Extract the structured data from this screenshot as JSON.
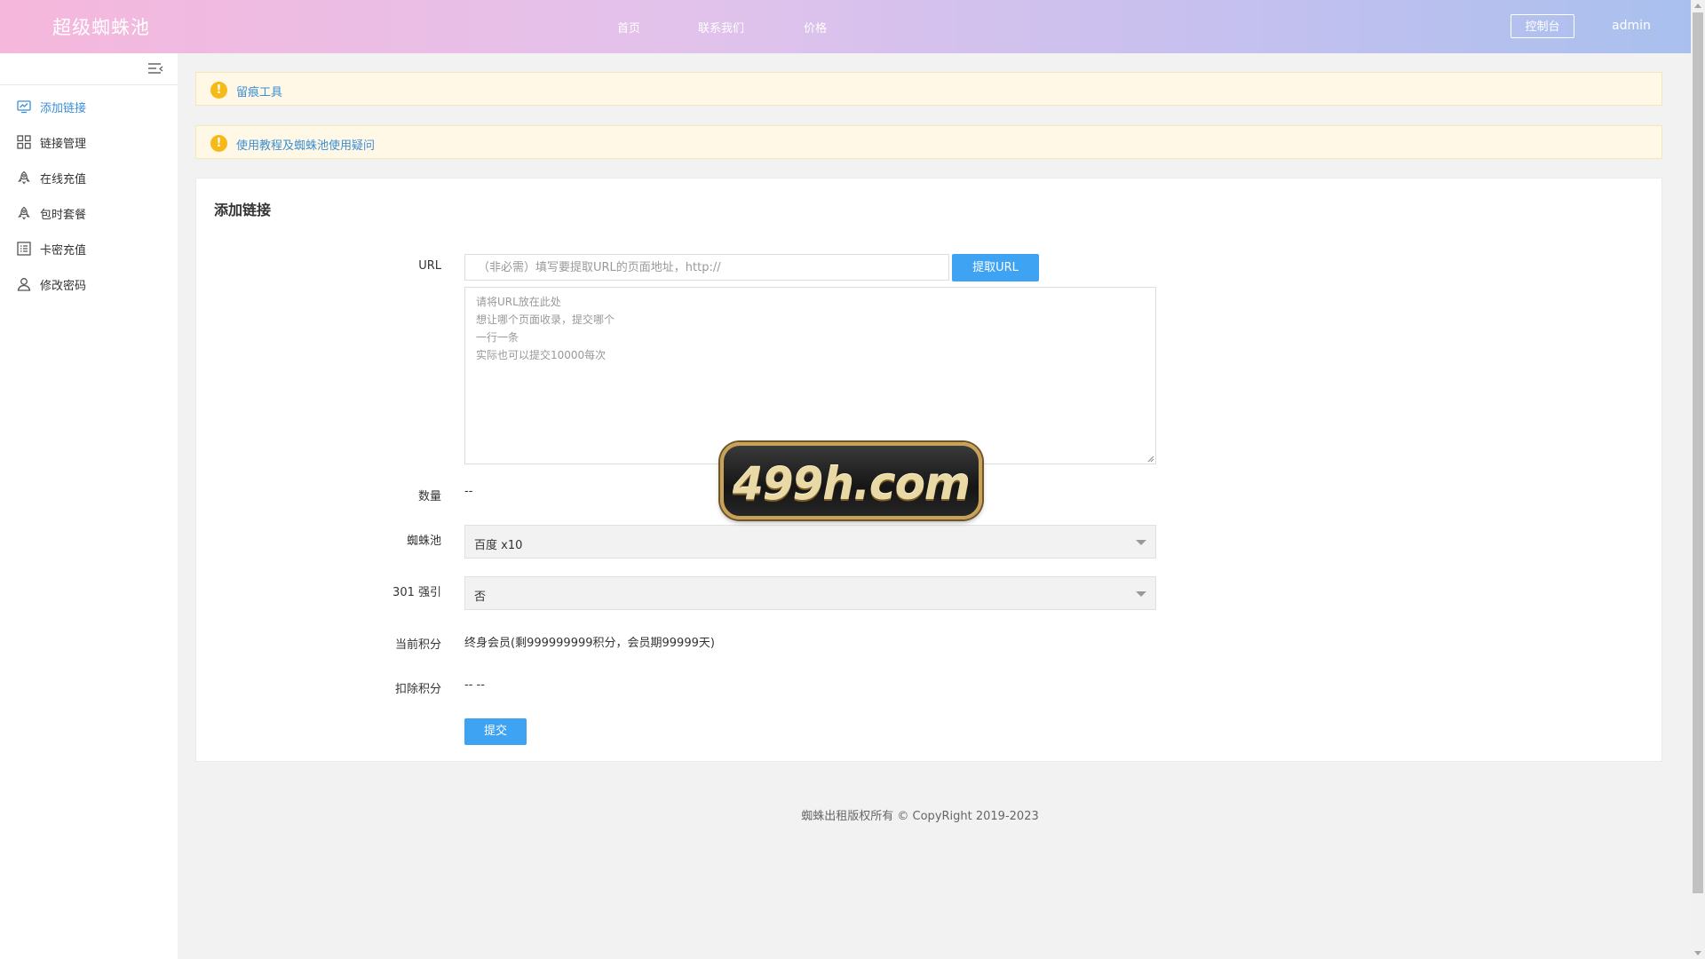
{
  "header": {
    "brand": "超级蜘蛛池",
    "nav": [
      "首页",
      "联系我们",
      "价格"
    ],
    "console_label": "控制台",
    "user": "admin"
  },
  "sidebar": {
    "items": [
      {
        "label": "添加链接",
        "icon": "chart-monitor-icon",
        "active": true
      },
      {
        "label": "链接管理",
        "icon": "grid-icon",
        "active": false
      },
      {
        "label": "在线充值",
        "icon": "rocket-icon",
        "active": false
      },
      {
        "label": "包时套餐",
        "icon": "rocket-icon",
        "active": false
      },
      {
        "label": "卡密充值",
        "icon": "list-icon",
        "active": false
      },
      {
        "label": "修改密码",
        "icon": "user-icon",
        "active": false
      }
    ]
  },
  "alerts": [
    {
      "text": "留痕工具"
    },
    {
      "text": "使用教程及蜘蛛池使用疑问"
    }
  ],
  "form": {
    "title": "添加链接",
    "url_label": "URL",
    "url_placeholder": "（非必需）填写要提取URL的页面地址，http://",
    "fetch_label": "提取URL",
    "textarea_placeholder": "请将URL放在此处\n想让哪个页面收录，提交哪个\n一行一条\n实际也可以提交10000每次",
    "count_label": "数量",
    "count_value": "--",
    "pool_label": "蜘蛛池",
    "pool_value": "百度 x10",
    "redirect_label": "301 强引",
    "redirect_value": "否",
    "points_label": "当前积分",
    "points_value": "终身会员(剩999999999积分，会员期99999天)",
    "deduct_label": "扣除积分",
    "deduct_value": "-- --",
    "submit_label": "提交"
  },
  "watermark": "499h.com",
  "footer": "蜘蛛出租版权所有 © CopyRight 2019-2023"
}
